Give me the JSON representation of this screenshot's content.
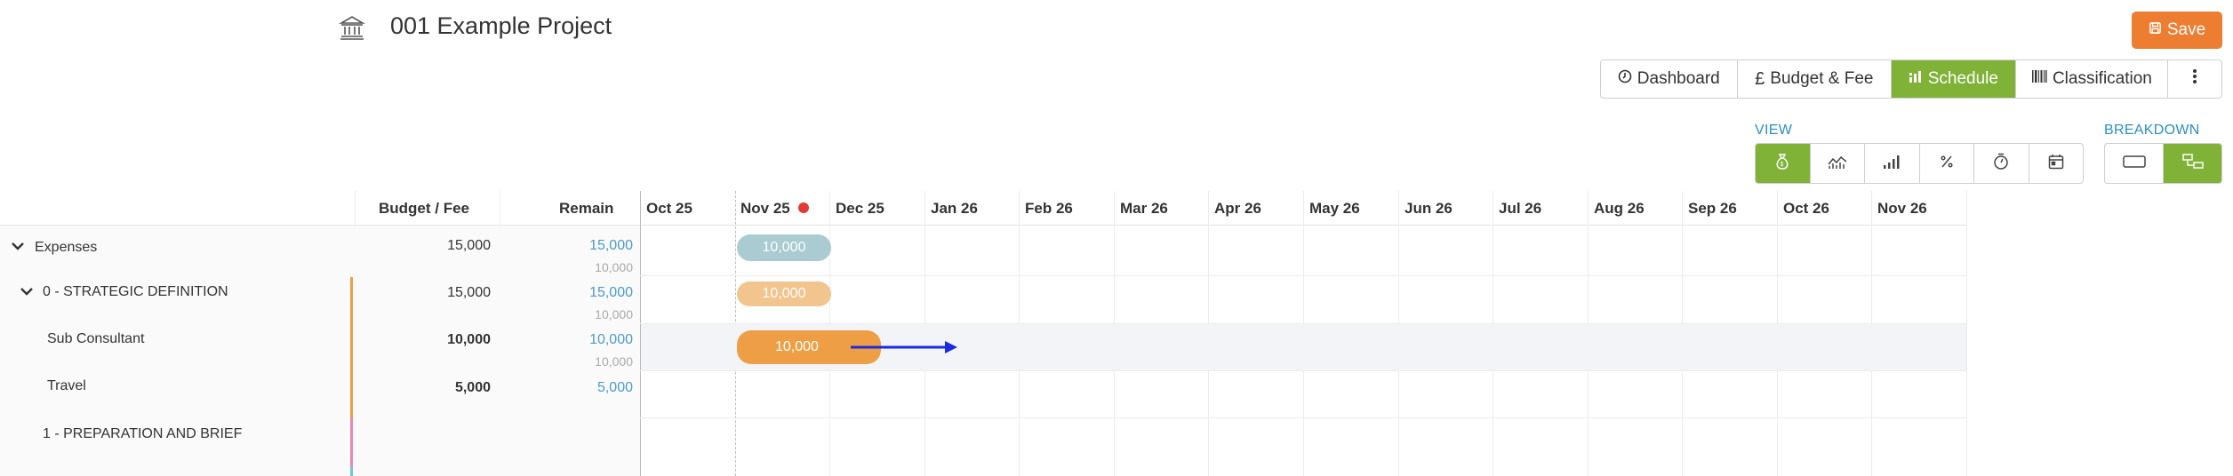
{
  "header": {
    "title": "001 Example Project",
    "save_label": "Save"
  },
  "nav": {
    "items": [
      {
        "label": "Dashboard",
        "icon": "clock-icon"
      },
      {
        "label": "Budget & Fee",
        "icon": "pound-icon"
      },
      {
        "label": "Schedule",
        "icon": "chart-icon",
        "active": true
      },
      {
        "label": "Classification",
        "icon": "barcode-icon"
      }
    ]
  },
  "view": {
    "label": "VIEW",
    "buttons": [
      "money-bag-icon",
      "trend-icon",
      "bars-icon",
      "percent-icon",
      "timer-icon",
      "calendar-icon"
    ]
  },
  "breakdown": {
    "label": "BREAKDOWN"
  },
  "columns": {
    "budget": "Budget / Fee",
    "remain": "Remain"
  },
  "months": [
    "Oct 25",
    "Nov 25",
    "Dec 25",
    "Jan 26",
    "Feb 26",
    "Mar 26",
    "Apr 26",
    "May 26",
    "Jun 26",
    "Jul 26",
    "Aug 26",
    "Sep 26",
    "Oct 26",
    "Nov 26"
  ],
  "rows": [
    {
      "label": "Expenses",
      "budget": "15,000",
      "remain": "15,000",
      "remain_sub": "10,000",
      "bar": "10,000"
    },
    {
      "label": "0 - STRATEGIC DEFINITION",
      "budget": "15,000",
      "remain": "15,000",
      "remain_sub": "10,000",
      "bar": "10,000"
    },
    {
      "label": "Sub Consultant",
      "budget": "10,000",
      "remain": "10,000",
      "remain_sub": "10,000",
      "bar": "10,000"
    },
    {
      "label": "Travel",
      "budget": "5,000",
      "remain": "5,000"
    },
    {
      "label": "1 - PREPARATION AND BRIEF"
    }
  ],
  "colors": {
    "accent_orange": "#ed7d31",
    "accent_green": "#7fb237",
    "link_blue": "#2a8fc2",
    "bar_teal": "#a9cbd1",
    "bar_peach": "#f2c58e",
    "bar_orange": "#ee9f45",
    "arrow_blue": "#1a2be0"
  }
}
